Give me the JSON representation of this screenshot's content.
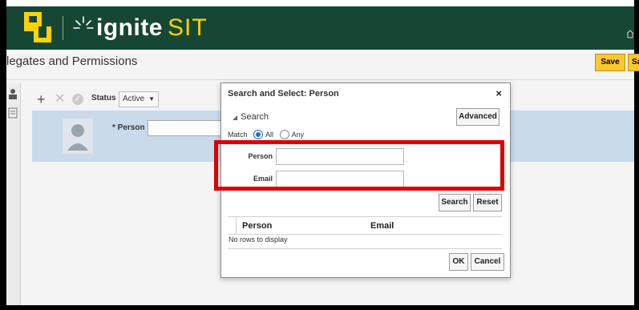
{
  "header": {
    "brand_word": "ignite",
    "brand_env": "SIT",
    "home_icon": "home-icon",
    "logo_icon": "bu-logo-icon",
    "color_bg": "#154734",
    "color_accent": "#ffd200"
  },
  "page": {
    "title": "legates and Permissions",
    "save_label": "Save",
    "save2_label": "Sa"
  },
  "toolbar": {
    "add_icon": "plus-icon",
    "delete_icon": "close-icon",
    "status_icon": "check-icon",
    "status_label": "Status",
    "status_value": "Active"
  },
  "panel": {
    "person_label": "* Person"
  },
  "modal": {
    "title": "Search and Select: Person",
    "close": "×",
    "search_label": "Search",
    "advanced_label": "Advanced",
    "match_label": "Match",
    "match_all": "All",
    "match_any": "Any",
    "person_label": "Person",
    "email_label": "Email",
    "search_btn": "Search",
    "reset_btn": "Reset",
    "col_person": "Person",
    "col_email": "Email",
    "empty_text": "No rows to display",
    "ok_btn": "OK",
    "cancel_btn": "Cancel"
  },
  "highlight_color": "#e00000"
}
